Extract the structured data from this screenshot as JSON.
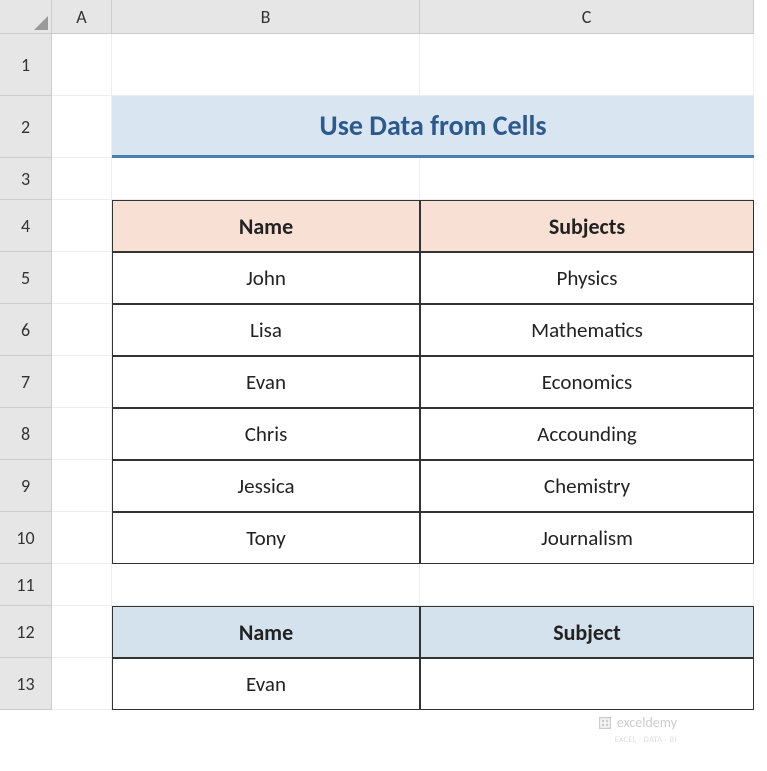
{
  "columns": [
    "A",
    "B",
    "C"
  ],
  "rows": [
    "1",
    "2",
    "3",
    "4",
    "5",
    "6",
    "7",
    "8",
    "9",
    "10",
    "11",
    "12",
    "13"
  ],
  "title": "Use Data from Cells",
  "table1": {
    "headers": [
      "Name",
      "Subjects"
    ],
    "rows": [
      [
        "John",
        "Physics"
      ],
      [
        "Lisa",
        "Mathematics"
      ],
      [
        "Evan",
        "Economics"
      ],
      [
        "Chris",
        "Accounding"
      ],
      [
        "Jessica",
        "Chemistry"
      ],
      [
        "Tony",
        "Journalism"
      ]
    ]
  },
  "table2": {
    "headers": [
      "Name",
      "Subject"
    ],
    "rows": [
      [
        "Evan",
        ""
      ]
    ]
  },
  "watermark": {
    "text": "exceldemy",
    "sub": "EXCEL · DATA · BI"
  }
}
